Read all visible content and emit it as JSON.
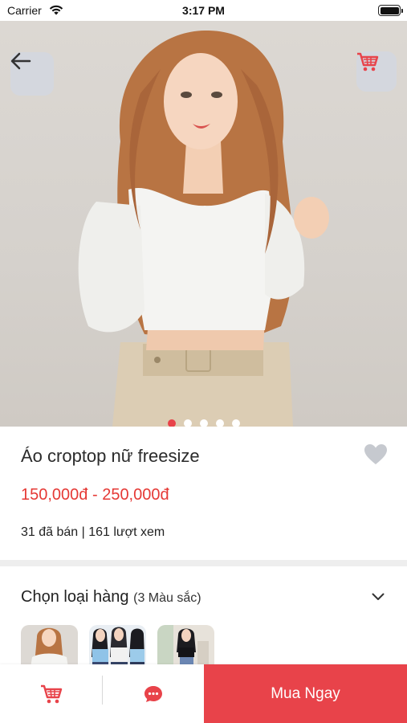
{
  "status_bar": {
    "carrier": "Carrier",
    "time": "3:17 PM"
  },
  "hero": {
    "image_count": 5,
    "active_index": 0
  },
  "product": {
    "title": "Áo croptop nữ freesize",
    "price_range": "150,000đ - 250,000đ",
    "stats": "31 đã bán | 161 lượt xem"
  },
  "variant": {
    "label": "Chọn loại hàng",
    "count_text": "(3 Màu sắc)"
  },
  "bottom_bar": {
    "buy_label": "Mua Ngay"
  },
  "colors": {
    "accent": "#e8434a",
    "price": "#e53935"
  }
}
